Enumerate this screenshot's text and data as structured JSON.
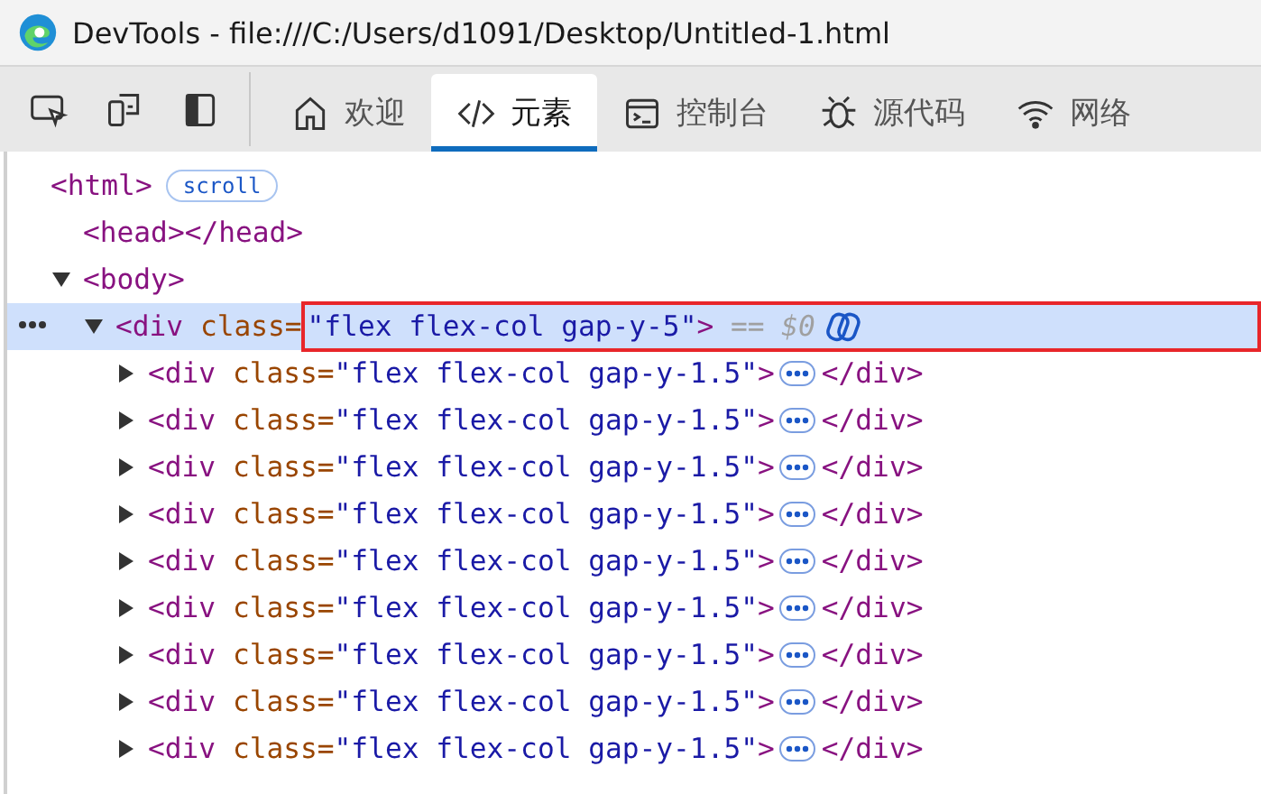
{
  "window": {
    "title": "DevTools - file:///C:/Users/d1091/Desktop/Untitled-1.html"
  },
  "tabs": [
    {
      "label": "欢迎",
      "selected": false
    },
    {
      "label": "元素",
      "selected": true
    },
    {
      "label": "控制台",
      "selected": false
    },
    {
      "label": "源代码",
      "selected": false
    },
    {
      "label": "网络",
      "selected": false
    }
  ],
  "dom_tree": [
    {
      "selected": false,
      "tokens": [
        {
          "kind": "tag",
          "text": "<html>"
        },
        {
          "kind": "badge",
          "text": "scroll"
        }
      ],
      "children": [
        {
          "selected": false,
          "tokens": [
            {
              "kind": "tag",
              "text": "<head></head>"
            }
          ]
        },
        {
          "selected": false,
          "expanded": true,
          "tokens": [
            {
              "kind": "tag",
              "text": "<body>"
            }
          ],
          "children": [
            {
              "selected": true,
              "expanded": true,
              "tokens": [
                {
                  "kind": "tag",
                  "text": "<div"
                },
                {
                  "kind": "attr",
                  "text": " class="
                },
                {
                  "kind": "value",
                  "text": "\"flex flex-col gap-y-5\"",
                  "highlight": true
                },
                {
                  "kind": "tag",
                  "text": ">",
                  "highlight": true
                },
                {
                  "kind": "hint",
                  "text": " == $0",
                  "highlight": true
                },
                {
                  "kind": "copilot",
                  "highlight": true
                }
              ],
              "children": [
                {
                  "selected": false,
                  "expanded": false,
                  "tokens": [
                    {
                      "kind": "tag",
                      "text": "<div"
                    },
                    {
                      "kind": "attr",
                      "text": " class="
                    },
                    {
                      "kind": "value",
                      "text": "\"flex flex-col gap-y-1.5\""
                    },
                    {
                      "kind": "tag",
                      "text": ">"
                    },
                    {
                      "kind": "more"
                    },
                    {
                      "kind": "tag",
                      "text": "</div>"
                    }
                  ]
                },
                {
                  "selected": false,
                  "expanded": false,
                  "tokens": [
                    {
                      "kind": "tag",
                      "text": "<div"
                    },
                    {
                      "kind": "attr",
                      "text": " class="
                    },
                    {
                      "kind": "value",
                      "text": "\"flex flex-col gap-y-1.5\""
                    },
                    {
                      "kind": "tag",
                      "text": ">"
                    },
                    {
                      "kind": "more"
                    },
                    {
                      "kind": "tag",
                      "text": "</div>"
                    }
                  ]
                },
                {
                  "selected": false,
                  "expanded": false,
                  "tokens": [
                    {
                      "kind": "tag",
                      "text": "<div"
                    },
                    {
                      "kind": "attr",
                      "text": " class="
                    },
                    {
                      "kind": "value",
                      "text": "\"flex flex-col gap-y-1.5\""
                    },
                    {
                      "kind": "tag",
                      "text": ">"
                    },
                    {
                      "kind": "more"
                    },
                    {
                      "kind": "tag",
                      "text": "</div>"
                    }
                  ]
                },
                {
                  "selected": false,
                  "expanded": false,
                  "tokens": [
                    {
                      "kind": "tag",
                      "text": "<div"
                    },
                    {
                      "kind": "attr",
                      "text": " class="
                    },
                    {
                      "kind": "value",
                      "text": "\"flex flex-col gap-y-1.5\""
                    },
                    {
                      "kind": "tag",
                      "text": ">"
                    },
                    {
                      "kind": "more"
                    },
                    {
                      "kind": "tag",
                      "text": "</div>"
                    }
                  ]
                },
                {
                  "selected": false,
                  "expanded": false,
                  "tokens": [
                    {
                      "kind": "tag",
                      "text": "<div"
                    },
                    {
                      "kind": "attr",
                      "text": " class="
                    },
                    {
                      "kind": "value",
                      "text": "\"flex flex-col gap-y-1.5\""
                    },
                    {
                      "kind": "tag",
                      "text": ">"
                    },
                    {
                      "kind": "more"
                    },
                    {
                      "kind": "tag",
                      "text": "</div>"
                    }
                  ]
                },
                {
                  "selected": false,
                  "expanded": false,
                  "tokens": [
                    {
                      "kind": "tag",
                      "text": "<div"
                    },
                    {
                      "kind": "attr",
                      "text": " class="
                    },
                    {
                      "kind": "value",
                      "text": "\"flex flex-col gap-y-1.5\""
                    },
                    {
                      "kind": "tag",
                      "text": ">"
                    },
                    {
                      "kind": "more"
                    },
                    {
                      "kind": "tag",
                      "text": "</div>"
                    }
                  ]
                },
                {
                  "selected": false,
                  "expanded": false,
                  "tokens": [
                    {
                      "kind": "tag",
                      "text": "<div"
                    },
                    {
                      "kind": "attr",
                      "text": " class="
                    },
                    {
                      "kind": "value",
                      "text": "\"flex flex-col gap-y-1.5\""
                    },
                    {
                      "kind": "tag",
                      "text": ">"
                    },
                    {
                      "kind": "more"
                    },
                    {
                      "kind": "tag",
                      "text": "</div>"
                    }
                  ]
                },
                {
                  "selected": false,
                  "expanded": false,
                  "tokens": [
                    {
                      "kind": "tag",
                      "text": "<div"
                    },
                    {
                      "kind": "attr",
                      "text": " class="
                    },
                    {
                      "kind": "value",
                      "text": "\"flex flex-col gap-y-1.5\""
                    },
                    {
                      "kind": "tag",
                      "text": ">"
                    },
                    {
                      "kind": "more"
                    },
                    {
                      "kind": "tag",
                      "text": "</div>"
                    }
                  ]
                },
                {
                  "selected": false,
                  "expanded": false,
                  "tokens": [
                    {
                      "kind": "tag",
                      "text": "<div"
                    },
                    {
                      "kind": "attr",
                      "text": " class="
                    },
                    {
                      "kind": "value",
                      "text": "\"flex flex-col gap-y-1.5\""
                    },
                    {
                      "kind": "tag",
                      "text": ">"
                    },
                    {
                      "kind": "more"
                    },
                    {
                      "kind": "tag",
                      "text": "</div>"
                    }
                  ]
                }
              ]
            }
          ]
        }
      ]
    }
  ]
}
